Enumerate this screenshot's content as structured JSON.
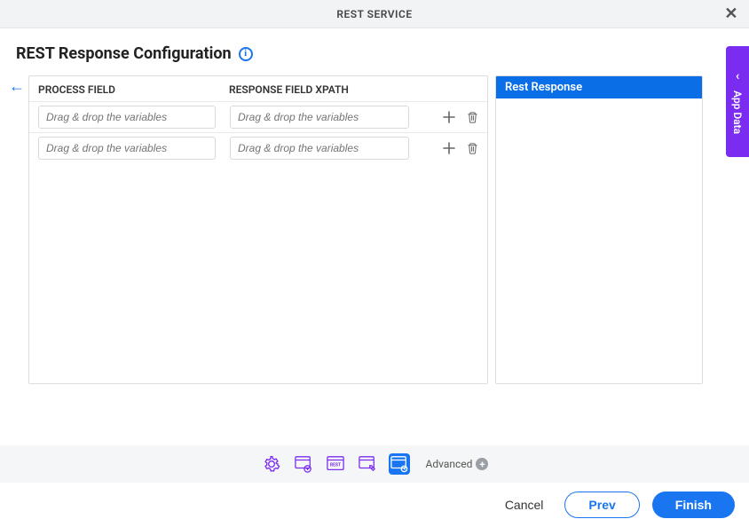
{
  "header": {
    "title": "REST SERVICE"
  },
  "page": {
    "title": "REST Response Configuration"
  },
  "table": {
    "headers": {
      "process": "PROCESS FIELD",
      "response": "RESPONSE FIELD XPATH"
    },
    "rows": [
      {
        "process_placeholder": "Drag & drop the variables",
        "response_placeholder": "Drag & drop the variables"
      },
      {
        "process_placeholder": "Drag & drop the variables",
        "response_placeholder": "Drag & drop the variables"
      }
    ]
  },
  "right_panel": {
    "title": "Rest Response"
  },
  "nav": {
    "icons": [
      {
        "name": "gear-icon"
      },
      {
        "name": "form-link-icon"
      },
      {
        "name": "rest-config-icon"
      },
      {
        "name": "form-edit-icon"
      },
      {
        "name": "response-timer-icon"
      }
    ],
    "advanced_label": "Advanced"
  },
  "footer": {
    "cancel": "Cancel",
    "prev": "Prev",
    "finish": "Finish"
  },
  "side_tab": {
    "label": "App Data"
  }
}
